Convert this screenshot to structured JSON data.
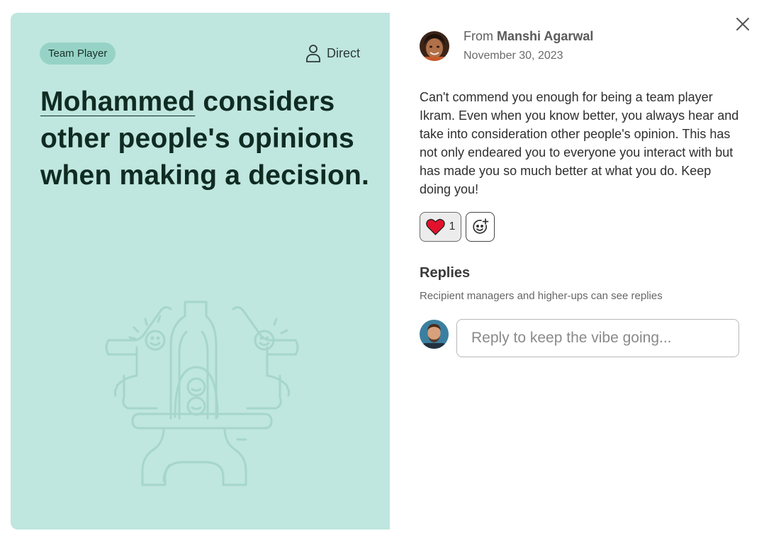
{
  "card": {
    "tag": "Team Player",
    "visibility": "Direct",
    "headline_name": "Mohammed",
    "headline_rest": " considers other people's opinions when making a decision.",
    "background_color": "#bfe6df"
  },
  "message": {
    "from_prefix": "From",
    "from_name": "Manshi Agarwal",
    "date": "November 30, 2023",
    "body": "Can't commend you enough for being a team player Ikram. Even when you know better, you always hear and take into consideration other people's opinion. This has not only endeared you to everyone you interact with but has made you so much better at what you do. Keep doing you!"
  },
  "reactions": {
    "heart_count": "1",
    "heart_icon": "heart-icon",
    "add_icon": "add-reaction-icon"
  },
  "replies": {
    "title": "Replies",
    "note": "Recipient managers and higher-ups can see replies",
    "placeholder": "Reply to keep the vibe going..."
  }
}
